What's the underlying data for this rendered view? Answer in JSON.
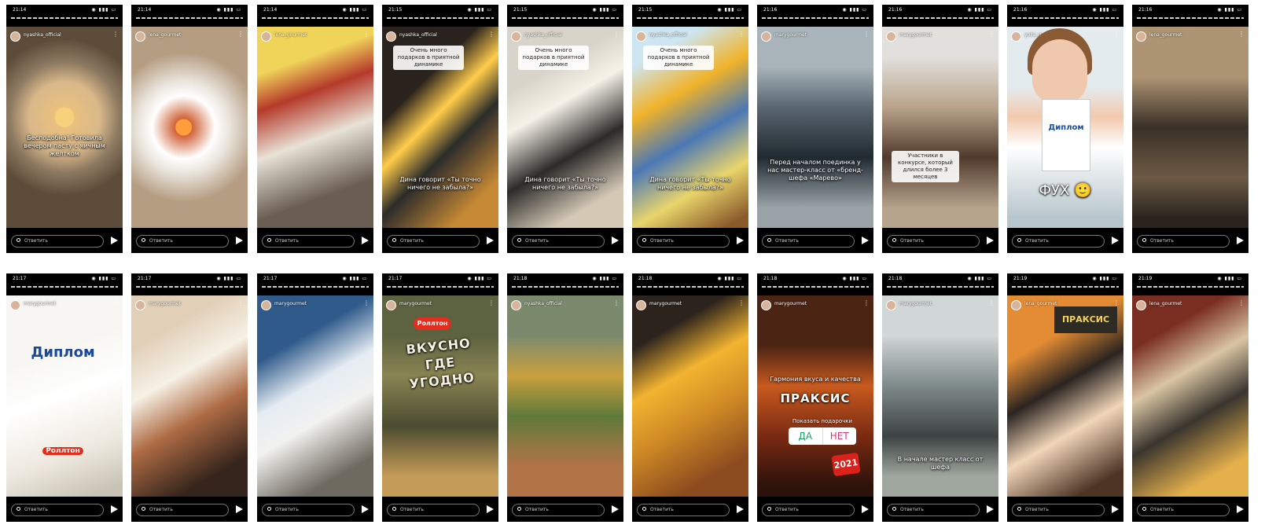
{
  "composer": {
    "reply_placeholder": "Ответить",
    "camera_icon": "camera-icon",
    "send_icon": "send-icon"
  },
  "status_icons": "◉ ▮▮▮ ▭",
  "menu_icon": "⋮",
  "stories": [
    {
      "time": "21:14",
      "user": "nyashka_official",
      "sub": "",
      "caption": "Бесподобна! Готовила вечером пасту с яичным желтком",
      "caption_style": "plain",
      "bg": "#caa77a"
    },
    {
      "time": "21:14",
      "user": "lena_gourmet",
      "sub": "",
      "caption": "",
      "caption_style": "none",
      "bg": "#c9b09a"
    },
    {
      "time": "21:14",
      "user": "lena_gourmet",
      "sub": "",
      "caption": "",
      "caption_style": "none",
      "bg": "#4d433e"
    },
    {
      "time": "21:15",
      "user": "nyashka_official",
      "sub": "",
      "caption": "Дина говорит «Ты точно ничего не забыла?»",
      "caption_style": "plain",
      "top_caption": "Очень много подарков в приятной динамике",
      "bg": "#3f3226"
    },
    {
      "time": "21:15",
      "user": "nyashka_official",
      "sub": "",
      "caption": "Дина говорит «Ты точно ничего не забыла?»",
      "caption_style": "plain",
      "top_caption": "Очень много подарков в приятной динамике",
      "bg": "#c7c1b8"
    },
    {
      "time": "21:15",
      "user": "nyashka_official",
      "sub": "",
      "caption": "Дина говорит «Ты точно ничего не забыла?»",
      "caption_style": "plain",
      "top_caption": "Очень много подарков в приятной динамике",
      "bg": "#d2a24a"
    },
    {
      "time": "21:16",
      "user": "marygourmet",
      "sub": "",
      "caption": "Перед началом поединка у нас мастер-класс от «бренд-шефа «Марево»",
      "caption_style": "plain",
      "bg": "#6d7a83"
    },
    {
      "time": "21:16",
      "user": "marygourmet",
      "sub": "",
      "caption": "Участники в конкурсе, который длился более 3 месяцев",
      "caption_style": "box",
      "bg": "#8f7f6c"
    },
    {
      "time": "21:16",
      "user": "yulia_gr",
      "sub": "",
      "caption": "",
      "caption_style": "none",
      "bg": "#c5d2d8"
    },
    {
      "time": "21:16",
      "user": "lena_gourmet",
      "sub": "",
      "caption": "",
      "caption_style": "none",
      "bg": "#6b5a48"
    },
    {
      "time": "21:17",
      "user": "marygourmet",
      "sub": "",
      "caption": "",
      "caption_style": "none",
      "bg": "#dcd8cf"
    },
    {
      "time": "21:17",
      "user": "marygourmet",
      "sub": "",
      "caption": "",
      "caption_style": "none",
      "bg": "#7d5846"
    },
    {
      "time": "21:17",
      "user": "marygourmet",
      "sub": "",
      "caption": "",
      "caption_style": "none",
      "bg": "#1e3a5c"
    },
    {
      "time": "21:17",
      "user": "marygourmet",
      "sub": "",
      "caption": "",
      "caption_style": "none",
      "bg": "#5b5b3c"
    },
    {
      "time": "21:18",
      "user": "nyashka_official",
      "sub": "",
      "caption": "",
      "caption_style": "none",
      "bg": "#5b6b3d"
    },
    {
      "time": "21:18",
      "user": "marygourmet",
      "sub": "",
      "caption": "",
      "caption_style": "none",
      "bg": "#8b5630"
    },
    {
      "time": "21:18",
      "user": "marygourmet",
      "sub": "",
      "caption": "Гармония вкуса и качества",
      "caption_style": "plain",
      "bg": "#6b2a12"
    },
    {
      "time": "21:18",
      "user": "marygourmet",
      "sub": "",
      "caption": "В начале мастер класс от шефа",
      "caption_style": "plain",
      "bg": "#707a79"
    },
    {
      "time": "21:19",
      "user": "lena_gourmet",
      "sub": "",
      "caption": "",
      "caption_style": "none",
      "bg": "#5a3a25"
    },
    {
      "time": "21:19",
      "user": "lena_gourmet",
      "sub": "",
      "caption": "",
      "caption_style": "none",
      "bg": "#3d3a33"
    }
  ],
  "extra": {
    "fuh_text": "ФУХ 🙂",
    "diploma_title": "Диплом",
    "poll_question": "Показать подарочки",
    "poll_yes": "ДА",
    "poll_no": "НЕТ",
    "praksis_label": "ПРАКСИС",
    "vkusno_label": "ВКУСНО ГДЕ УГОДНО",
    "sticker_2021": "2021",
    "rollton": "Роллтон"
  }
}
